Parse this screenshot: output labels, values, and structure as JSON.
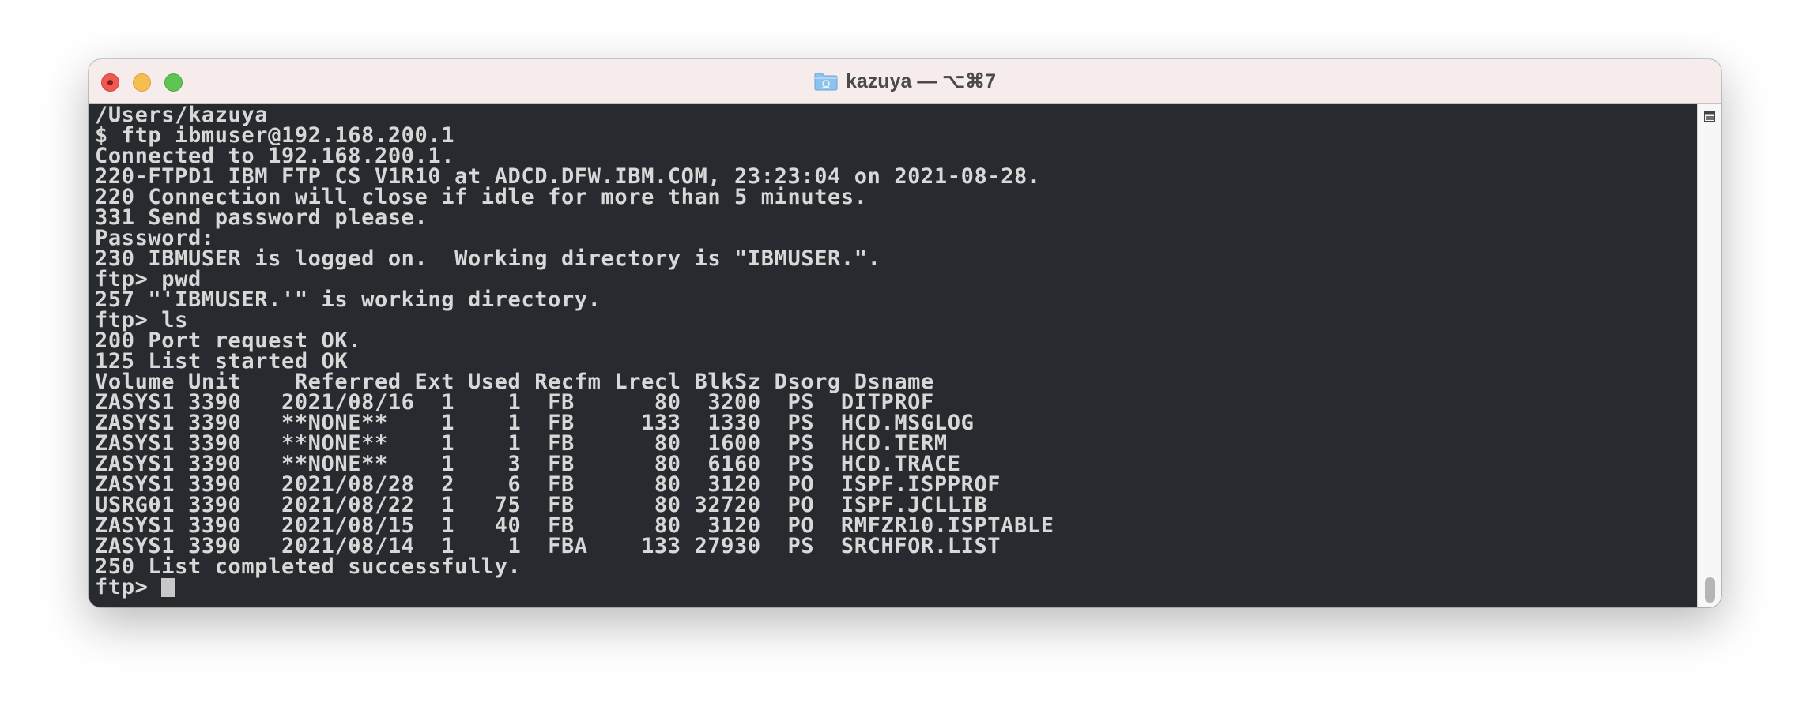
{
  "window": {
    "title": "kazuya — ⌥⌘7",
    "folder_icon": "folder-icon"
  },
  "colors": {
    "terminal_bg": "#272a2e",
    "terminal_text": "#d8d8d8",
    "titlebar_bg": "#f7ecec",
    "close": "#ee5a52",
    "minimize": "#f5be4f",
    "zoom": "#5fc454"
  },
  "terminal": {
    "lines": [
      "/Users/kazuya",
      "$ ftp ibmuser@192.168.200.1",
      "Connected to 192.168.200.1.",
      "220-FTPD1 IBM FTP CS V1R10 at ADCD.DFW.IBM.COM, 23:23:04 on 2021-08-28.",
      "220 Connection will close if idle for more than 5 minutes.",
      "331 Send password please.",
      "Password:",
      "230 IBMUSER is logged on.  Working directory is \"IBMUSER.\".",
      "ftp> pwd",
      "257 \"'IBMUSER.'\" is working directory.",
      "ftp> ls",
      "200 Port request OK.",
      "125 List started OK",
      "Volume Unit    Referred Ext Used Recfm Lrecl BlkSz Dsorg Dsname",
      "ZASYS1 3390   2021/08/16  1    1  FB      80  3200  PS  DITPROF",
      "ZASYS1 3390   **NONE**    1    1  FB     133  1330  PS  HCD.MSGLOG",
      "ZASYS1 3390   **NONE**    1    1  FB      80  1600  PS  HCD.TERM",
      "ZASYS1 3390   **NONE**    1    3  FB      80  6160  PS  HCD.TRACE",
      "ZASYS1 3390   2021/08/28  2    6  FB      80  3120  PO  ISPF.ISPPROF",
      "USRG01 3390   2021/08/22  1   75  FB      80 32720  PO  ISPF.JCLLIB",
      "ZASYS1 3390   2021/08/15  1   40  FB      80  3120  PO  RMFZR10.ISPTABLE",
      "ZASYS1 3390   2021/08/14  1    1  FBA    133 27930  PS  SRCHFOR.LIST",
      "250 List completed successfully."
    ],
    "prompt": "ftp> "
  },
  "scrollbar": {
    "menu_icon": "scroll-menu-icon"
  }
}
